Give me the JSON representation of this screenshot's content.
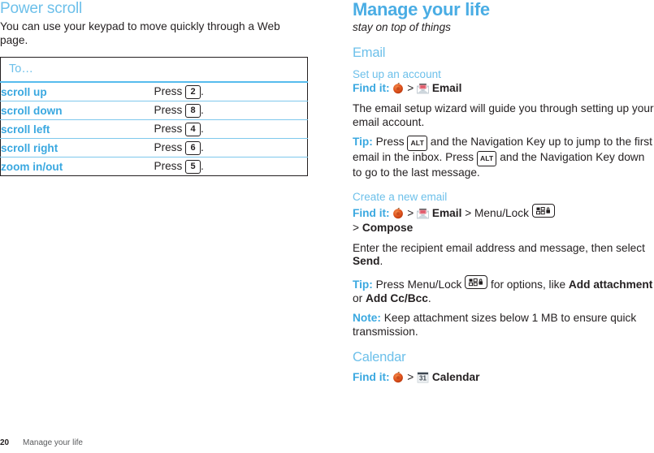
{
  "colors": {
    "heading_blue": "#6dc0ea",
    "accent_blue": "#3aa8e0",
    "table_rule_blue": "#7ec8ec",
    "header_rule_blue": "#56bced",
    "text": "#231f20",
    "footer_gray": "#58595b",
    "menu_icon_red": "#d94a1e",
    "mail_icon_red": "#e05a6a"
  },
  "left_column": {
    "heading": "Power scroll",
    "intro": "You can use your keypad to move quickly through a Web page.",
    "table": {
      "header": "To…",
      "columns": [
        "To…",
        ""
      ],
      "rows": [
        {
          "action": "scroll up",
          "press_label": "Press",
          "key": "2",
          "period": "."
        },
        {
          "action": "scroll down",
          "press_label": "Press",
          "key": "8",
          "period": "."
        },
        {
          "action": "scroll left",
          "press_label": "Press",
          "key": "4",
          "period": "."
        },
        {
          "action": "scroll right",
          "press_label": "Press",
          "key": "6",
          "period": "."
        },
        {
          "action": "zoom in/out",
          "press_label": "Press",
          "key": "5",
          "period": "."
        }
      ]
    }
  },
  "right_column": {
    "chapter_title": "Manage your life",
    "chapter_subtitle": "stay on top of things",
    "email_section": {
      "heading": "Email",
      "task1": {
        "title": "Set up an account",
        "findit_label": "Find it:",
        "sep": ">",
        "icons": [
          "menu-icon",
          "email-app-icon"
        ],
        "target": "Email",
        "body": "The email setup wizard will guide you through setting up your email account.",
        "tip_label": "Tip:",
        "tip_part1": "Press",
        "tip_key1": "ALT",
        "tip_part2": "and the Navigation Key up to jump to the first email in the inbox. Press",
        "tip_key2": "ALT",
        "tip_part3": "and the Navigation Key down to go to the last message."
      },
      "task2": {
        "title": "Create a new email",
        "findit_label": "Find it:",
        "sep": ">",
        "target": "Email",
        "menu_lock_label": "Menu/Lock",
        "compose_prefix": ">",
        "compose": "Compose",
        "body_part1": "Enter the recipient email address and message, then select",
        "body_bold": "Send",
        "body_period": ".",
        "tip_label": "Tip:",
        "tip_part1": "Press Menu/Lock",
        "tip_part2": "for options, like",
        "tip_bold1": "Add attachment",
        "tip_or": "or",
        "tip_bold2": "Add Cc/Bcc",
        "tip_period": ".",
        "note_label": "Note:",
        "note_text": "Keep attachment sizes below 1 MB to ensure quick transmission."
      }
    },
    "calendar_section": {
      "heading": "Calendar",
      "findit_label": "Find it:",
      "sep": ">",
      "target": "Calendar",
      "calendar_icon_day": "31"
    }
  },
  "footer": {
    "page_number": "20",
    "title": "Manage your life"
  }
}
